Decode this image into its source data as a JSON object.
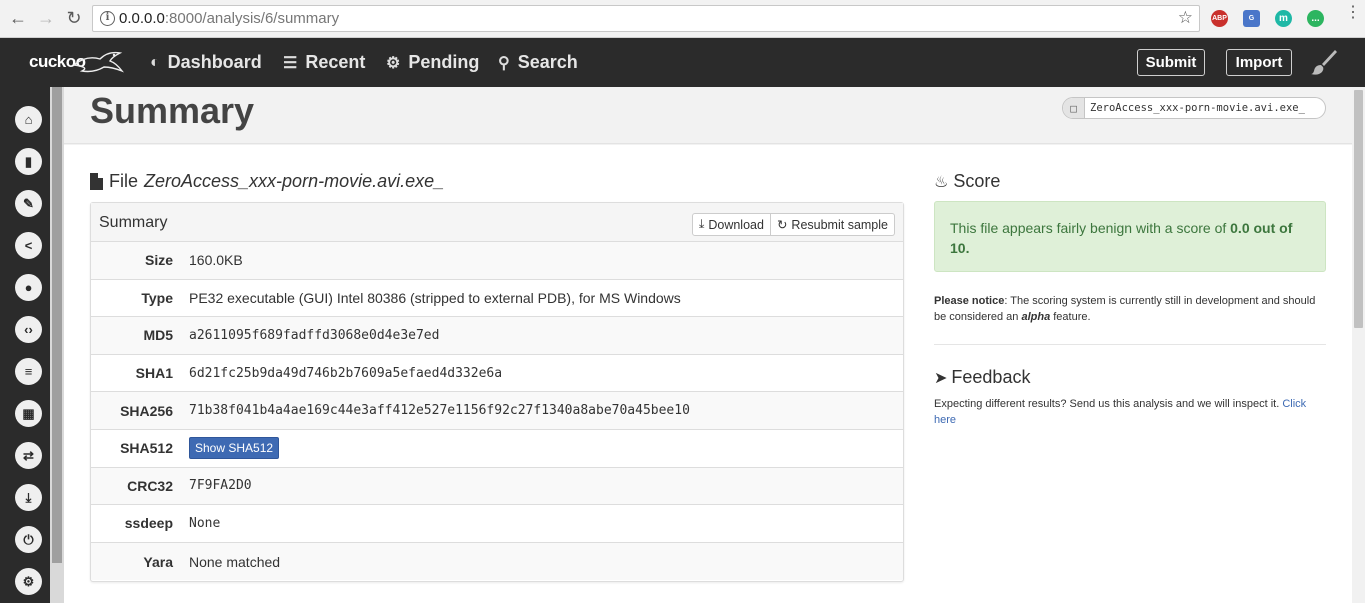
{
  "browser": {
    "url_host": "0.0.0.0",
    "url_rest": ":8000/analysis/6/summary",
    "extensions": [
      "ABP",
      "G",
      "m",
      "..."
    ]
  },
  "navbar": {
    "logo": "cuckoo",
    "items": [
      {
        "label": "Dashboard",
        "icon": "dashboard-icon"
      },
      {
        "label": "Recent",
        "icon": "list-icon"
      },
      {
        "label": "Pending",
        "icon": "gears-icon"
      },
      {
        "label": "Search",
        "icon": "search-icon"
      }
    ],
    "submit": "Submit",
    "import": "Import"
  },
  "sidebar": {
    "items": [
      "home-icon",
      "book-icon",
      "pencil-icon",
      "share-icon",
      "globe-icon",
      "code-file-icon",
      "server-icon",
      "qrcode-icon",
      "shuffle-icon",
      "download-icon",
      "power-icon",
      "settings-icon"
    ]
  },
  "header": {
    "title": "Summary",
    "file_pill": "ZeroAccess_xxx-porn-movie.avi.exe_"
  },
  "file": {
    "label": "File",
    "name": "ZeroAccess_xxx-porn-movie.avi.exe_"
  },
  "summary_panel": {
    "title": "Summary",
    "download": "Download",
    "resubmit": "Resubmit sample",
    "rows": [
      {
        "key": "Size",
        "value": "160.0KB"
      },
      {
        "key": "Type",
        "value": "PE32 executable (GUI) Intel 80386 (stripped to external PDB), for MS Windows"
      },
      {
        "key": "MD5",
        "value": "a2611095f689fadffd3068e0d4e3e7ed"
      },
      {
        "key": "SHA1",
        "value": "6d21fc25b9da49d746b2b7609a5efaed4d332e6a"
      },
      {
        "key": "SHA256",
        "value": "71b38f041b4a4ae169c44e3aff412e527e1156f92c27f1340a8abe70a45bee10"
      },
      {
        "key": "SHA512",
        "value": "Show SHA512"
      },
      {
        "key": "CRC32",
        "value": "7F9FA2D0"
      },
      {
        "key": "ssdeep",
        "value": "None"
      },
      {
        "key": "Yara",
        "value": "None matched"
      }
    ]
  },
  "score": {
    "title": "Score",
    "text_before": "This file appears fairly benign with a score of ",
    "score_value": "0.0 out of 10.",
    "notice_label": "Please notice",
    "notice_text_1": ": The scoring system is currently still in development and should be considered an ",
    "notice_alpha": "alpha",
    "notice_text_2": " feature."
  },
  "feedback": {
    "title": "Feedback",
    "text": "Expecting different results? Send us this analysis and we will inspect it. ",
    "link": "Click here"
  }
}
